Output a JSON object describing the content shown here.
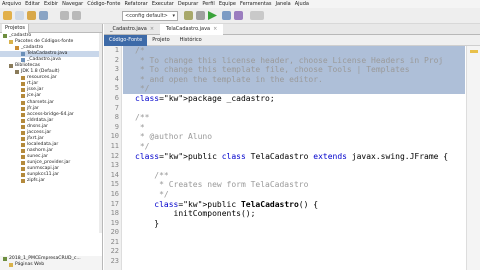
{
  "menu": [
    "Arquivo",
    "Editar",
    "Exibir",
    "Navegar",
    "Código-Fonte",
    "Refatorar",
    "Executar",
    "Depurar",
    "Perfil",
    "Equipe",
    "Ferramentas",
    "Janela",
    "Ajuda"
  ],
  "toolbar": {
    "config": "<config default>"
  },
  "left_panel": {
    "tabs": [
      "Projetos",
      "Arquivos"
    ],
    "tree": [
      {
        "label": "_cadastro",
        "indent": 0,
        "type": "proj"
      },
      {
        "label": "Pacotes de Códigos-fonte",
        "indent": 1,
        "type": "folder"
      },
      {
        "label": "_cadastro",
        "indent": 2,
        "type": "pkg"
      },
      {
        "label": "TelaCadastro.java",
        "indent": 3,
        "type": "java",
        "selected": true
      },
      {
        "label": "_Cadastro.java",
        "indent": 3,
        "type": "java"
      },
      {
        "label": "Bibliotecas",
        "indent": 1,
        "type": "lib"
      },
      {
        "label": "JDK 1.8 (Default)",
        "indent": 2,
        "type": "lib"
      },
      {
        "label": "resources.jar",
        "indent": 3,
        "type": "jar"
      },
      {
        "label": "rt.jar",
        "indent": 3,
        "type": "jar"
      },
      {
        "label": "jsse.jar",
        "indent": 3,
        "type": "jar"
      },
      {
        "label": "jce.jar",
        "indent": 3,
        "type": "jar"
      },
      {
        "label": "charsets.jar",
        "indent": 3,
        "type": "jar"
      },
      {
        "label": "jfr.jar",
        "indent": 3,
        "type": "jar"
      },
      {
        "label": "access-bridge-64.jar",
        "indent": 3,
        "type": "jar"
      },
      {
        "label": "cldrdata.jar",
        "indent": 3,
        "type": "jar"
      },
      {
        "label": "dnsns.jar",
        "indent": 3,
        "type": "jar"
      },
      {
        "label": "jaccess.jar",
        "indent": 3,
        "type": "jar"
      },
      {
        "label": "jfxrt.jar",
        "indent": 3,
        "type": "jar"
      },
      {
        "label": "localedata.jar",
        "indent": 3,
        "type": "jar"
      },
      {
        "label": "nashorn.jar",
        "indent": 3,
        "type": "jar"
      },
      {
        "label": "sunec.jar",
        "indent": 3,
        "type": "jar"
      },
      {
        "label": "sunjce_provider.jar",
        "indent": 3,
        "type": "jar"
      },
      {
        "label": "sunmscapi.jar",
        "indent": 3,
        "type": "jar"
      },
      {
        "label": "sunpkcs11.jar",
        "indent": 3,
        "type": "jar"
      },
      {
        "label": "zipfs.jar",
        "indent": 3,
        "type": "jar"
      }
    ],
    "bottom_items": [
      {
        "label": "2018_1_PMCEmpresaCRUD_c...",
        "type": "proj"
      },
      {
        "label": "Páginas Web",
        "type": "folder"
      }
    ]
  },
  "editor": {
    "tabs": [
      {
        "label": "_Cadastro.java",
        "active": false
      },
      {
        "label": "TelaCadastro.java",
        "active": true
      }
    ],
    "subtabs": [
      "Código-Fonte",
      "Projeto",
      "Histórico"
    ],
    "lines": [
      {
        "n": "1",
        "text": "/*",
        "hl": true,
        "cls": "cm"
      },
      {
        "n": "2",
        "text": " * To change this license header, choose License Headers in Proj",
        "hl": true,
        "cls": "cm"
      },
      {
        "n": "3",
        "text": " * To change this template file, choose Tools | Templates",
        "hl": true,
        "cls": "cm"
      },
      {
        "n": "4",
        "text": " * and open the template in the editor.",
        "hl": true,
        "cls": "cm"
      },
      {
        "n": "5",
        "text": " */",
        "hl": true,
        "cls": "cm"
      },
      {
        "n": "6",
        "text": "package _cadastro;",
        "hl": false,
        "cls": ""
      },
      {
        "n": "7",
        "text": "",
        "hl": false,
        "cls": ""
      },
      {
        "n": "8",
        "text": "/**",
        "hl": false,
        "cls": "cm"
      },
      {
        "n": "9",
        "text": " *",
        "hl": false,
        "cls": "cm"
      },
      {
        "n": "10",
        "text": " * @author Aluno",
        "hl": false,
        "cls": "cm"
      },
      {
        "n": "11",
        "text": " */",
        "hl": false,
        "cls": "cm"
      },
      {
        "n": "12",
        "text": "public class TelaCadastro extends javax.swing.JFrame {",
        "hl": false,
        "cls": ""
      },
      {
        "n": "13",
        "text": "",
        "hl": false,
        "cls": ""
      },
      {
        "n": "14",
        "text": "    /**",
        "hl": false,
        "cls": "cm"
      },
      {
        "n": "15",
        "text": "     * Creates new form TelaCadastro",
        "hl": false,
        "cls": "cm"
      },
      {
        "n": "16",
        "text": "     */",
        "hl": false,
        "cls": "cm"
      },
      {
        "n": "17",
        "text": "    public TelaCadastro() {",
        "hl": false,
        "cls": ""
      },
      {
        "n": "18",
        "text": "        initComponents();",
        "hl": false,
        "cls": ""
      },
      {
        "n": "19",
        "text": "    }",
        "hl": false,
        "cls": ""
      },
      {
        "n": "20",
        "text": "",
        "hl": false,
        "cls": ""
      },
      {
        "n": "21",
        "text": "",
        "hl": false,
        "cls": ""
      },
      {
        "n": "22",
        "text": "",
        "hl": false,
        "cls": ""
      },
      {
        "n": "23",
        "text": "",
        "hl": false,
        "cls": ""
      }
    ]
  },
  "colors": {
    "selection": "#aebfd8",
    "keyword": "#0000cc",
    "comment": "#9a9a9a",
    "active_subtab": "#3d6aa8"
  }
}
